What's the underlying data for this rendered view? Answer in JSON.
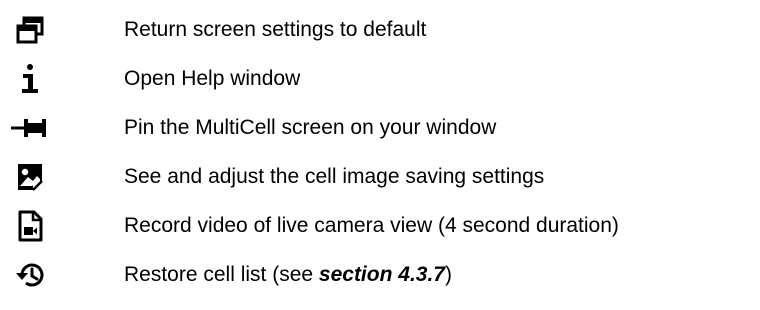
{
  "legend": {
    "items": [
      {
        "icon": "restore-windows-icon",
        "label": "Return screen settings to default"
      },
      {
        "icon": "info-icon",
        "label": "Open Help window"
      },
      {
        "icon": "pin-icon",
        "label": "Pin the MultiCell screen on your window"
      },
      {
        "icon": "image-settings-icon",
        "label": "See and adjust the cell image saving settings"
      },
      {
        "icon": "video-file-icon",
        "label": "Record video of live camera view (4 second duration)"
      },
      {
        "icon": "history-restore-icon",
        "label_prefix": "Restore cell list (see ",
        "label_emphasis": "section 4.3.7",
        "label_suffix": ")"
      }
    ]
  }
}
